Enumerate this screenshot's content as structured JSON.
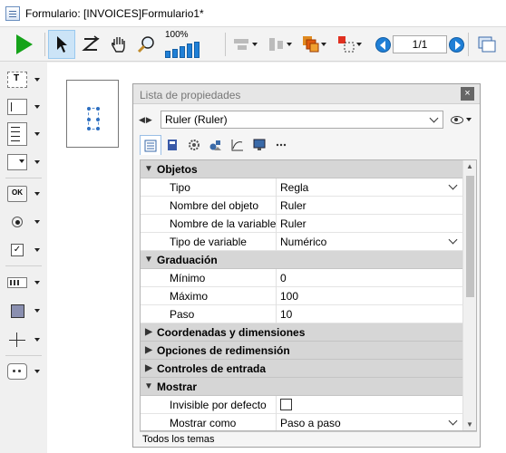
{
  "window": {
    "title": "Formulario: [INVOICES]Formulario1*"
  },
  "toolbar": {
    "zoom_label": "100%",
    "page_indicator": "1/1"
  },
  "panel": {
    "title": "Lista de propiedades",
    "close_label": "×",
    "object_select": "Ruler (Ruler)",
    "footer": "Todos los temas",
    "sections": {
      "objetos": "Objetos",
      "graduacion": "Graduación",
      "coordenadas": "Coordenadas y dimensiones",
      "redimension": "Opciones de redimensión",
      "controles": "Controles de entrada",
      "mostrar": "Mostrar"
    },
    "props": {
      "tipo": {
        "label": "Tipo",
        "value": "Regla"
      },
      "nombre_objeto": {
        "label": "Nombre del objeto",
        "value": "Ruler"
      },
      "nombre_variable": {
        "label": "Nombre de la variable",
        "value": "Ruler"
      },
      "tipo_variable": {
        "label": "Tipo de variable",
        "value": "Numérico"
      },
      "minimo": {
        "label": "Mínimo",
        "value": "0"
      },
      "maximo": {
        "label": "Máximo",
        "value": "100"
      },
      "paso": {
        "label": "Paso",
        "value": "10"
      },
      "invisible": {
        "label": "Invisible por defecto",
        "checked": false
      },
      "mostrar_como": {
        "label": "Mostrar como",
        "value": "Paso a paso"
      }
    }
  }
}
